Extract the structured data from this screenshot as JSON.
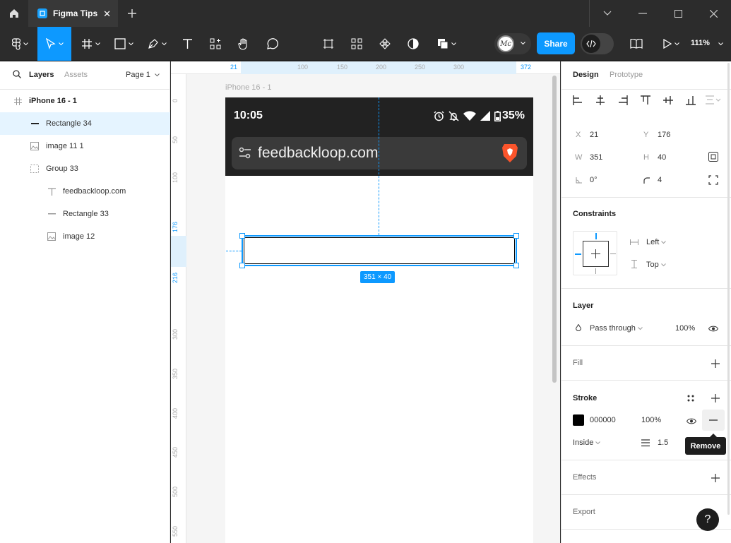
{
  "titlebar": {
    "tab_title": "Figma Tips",
    "close_glyph": "✕",
    "plus_glyph": "+"
  },
  "toolbar": {
    "share_label": "Share",
    "zoom": "111%",
    "avatar_initials": "Mc"
  },
  "left_panel": {
    "tab_layers": "Layers",
    "tab_assets": "Assets",
    "page": "Page 1",
    "layers": [
      {
        "name": "iPhone 16 - 1",
        "icon": "frame-icon",
        "indent": 0,
        "selected": false,
        "bold": true
      },
      {
        "name": "Rectangle 34",
        "icon": "line-icon",
        "indent": 1,
        "selected": true,
        "bold": false
      },
      {
        "name": "image 11 1",
        "icon": "image-icon",
        "indent": 1,
        "selected": false,
        "bold": false
      },
      {
        "name": "Group 33",
        "icon": "group-icon",
        "indent": 1,
        "selected": false,
        "bold": false
      },
      {
        "name": "feedbackloop.com",
        "icon": "text-icon",
        "indent": 2,
        "selected": false,
        "bold": false
      },
      {
        "name": "Rectangle 33",
        "icon": "line-icon",
        "indent": 2,
        "selected": false,
        "bold": false
      },
      {
        "name": "image 12",
        "icon": "image-icon",
        "indent": 2,
        "selected": false,
        "bold": false
      }
    ]
  },
  "canvas": {
    "ruler_top": [
      "21",
      "100",
      "150",
      "200",
      "250",
      "300",
      "372"
    ],
    "ruler_left": [
      "0",
      "50",
      "100",
      "176",
      "216",
      "300",
      "350",
      "400",
      "450",
      "500",
      "550"
    ],
    "frame_label": "iPhone 16 - 1",
    "status_time": "10:05",
    "battery": "35%",
    "url": "feedbackloop.com",
    "size_badge": "351 × 40"
  },
  "right_panel": {
    "tab_design": "Design",
    "tab_prototype": "Prototype",
    "x_label": "X",
    "x_value": "21",
    "y_label": "Y",
    "y_value": "176",
    "w_label": "W",
    "w_value": "351",
    "h_label": "H",
    "h_value": "40",
    "rotation": "0°",
    "radius": "4",
    "constraints_title": "Constraints",
    "constraint_h": "Left",
    "constraint_v": "Top",
    "layer_title": "Layer",
    "blend_mode": "Pass through",
    "layer_opacity": "100%",
    "fill_title": "Fill",
    "stroke_title": "Stroke",
    "stroke_color": "000000",
    "stroke_opacity": "100%",
    "stroke_position": "Inside",
    "stroke_weight": "1.5",
    "tooltip": "Remove",
    "effects_title": "Effects",
    "export_title": "Export",
    "help_glyph": "?"
  },
  "colors": {
    "accent": "#0d99ff",
    "dark": "#2c2c2c"
  }
}
